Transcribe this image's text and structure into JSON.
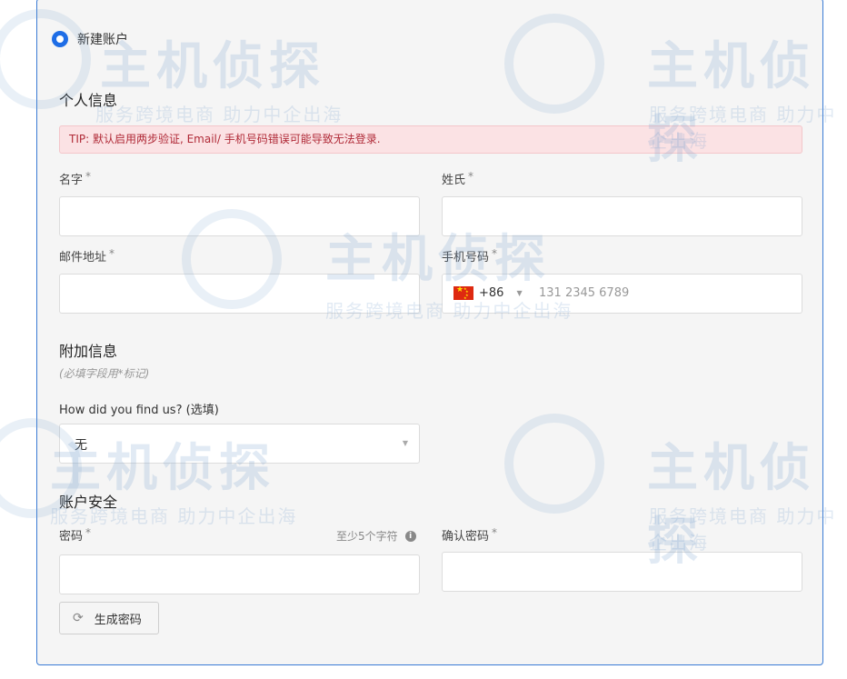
{
  "account_type": {
    "label": "新建账户"
  },
  "personal": {
    "title": "个人信息",
    "tip": "TIP: 默认启用两步验证, Email/ 手机号码错误可能导致无法登录.",
    "first_name": {
      "label": "名字",
      "required_mark": "*",
      "value": ""
    },
    "last_name": {
      "label": "姓氏",
      "required_mark": "*",
      "value": ""
    },
    "email": {
      "label": "邮件地址",
      "required_mark": "*",
      "value": ""
    },
    "phone": {
      "label": "手机号码",
      "required_mark": "*",
      "country_code": "+86",
      "placeholder": "131 2345 6789"
    }
  },
  "additional": {
    "title": "附加信息",
    "note": "(必填字段用*标记)",
    "referral": {
      "label": "How did you find us? (选填)",
      "selected": "无"
    }
  },
  "security": {
    "title": "账户安全",
    "password": {
      "label": "密码",
      "required_mark": "*",
      "hint": "至少5个字符",
      "value": ""
    },
    "confirm_password": {
      "label": "确认密码",
      "required_mark": "*",
      "value": ""
    },
    "generate_button": "生成密码"
  },
  "watermark": {
    "brand": "主机侦探",
    "slogan": "服务跨境电商 助力中企出海"
  },
  "colors": {
    "accent": "#1e6de6",
    "border": "#3a7bd5",
    "tip_bg": "#fbe2e4",
    "tip_text": "#b02a37"
  },
  "icons": {
    "info": "info-icon",
    "refresh": "refresh-icon",
    "flag": "china-flag-icon",
    "dropdown": "chevron-down-icon"
  }
}
